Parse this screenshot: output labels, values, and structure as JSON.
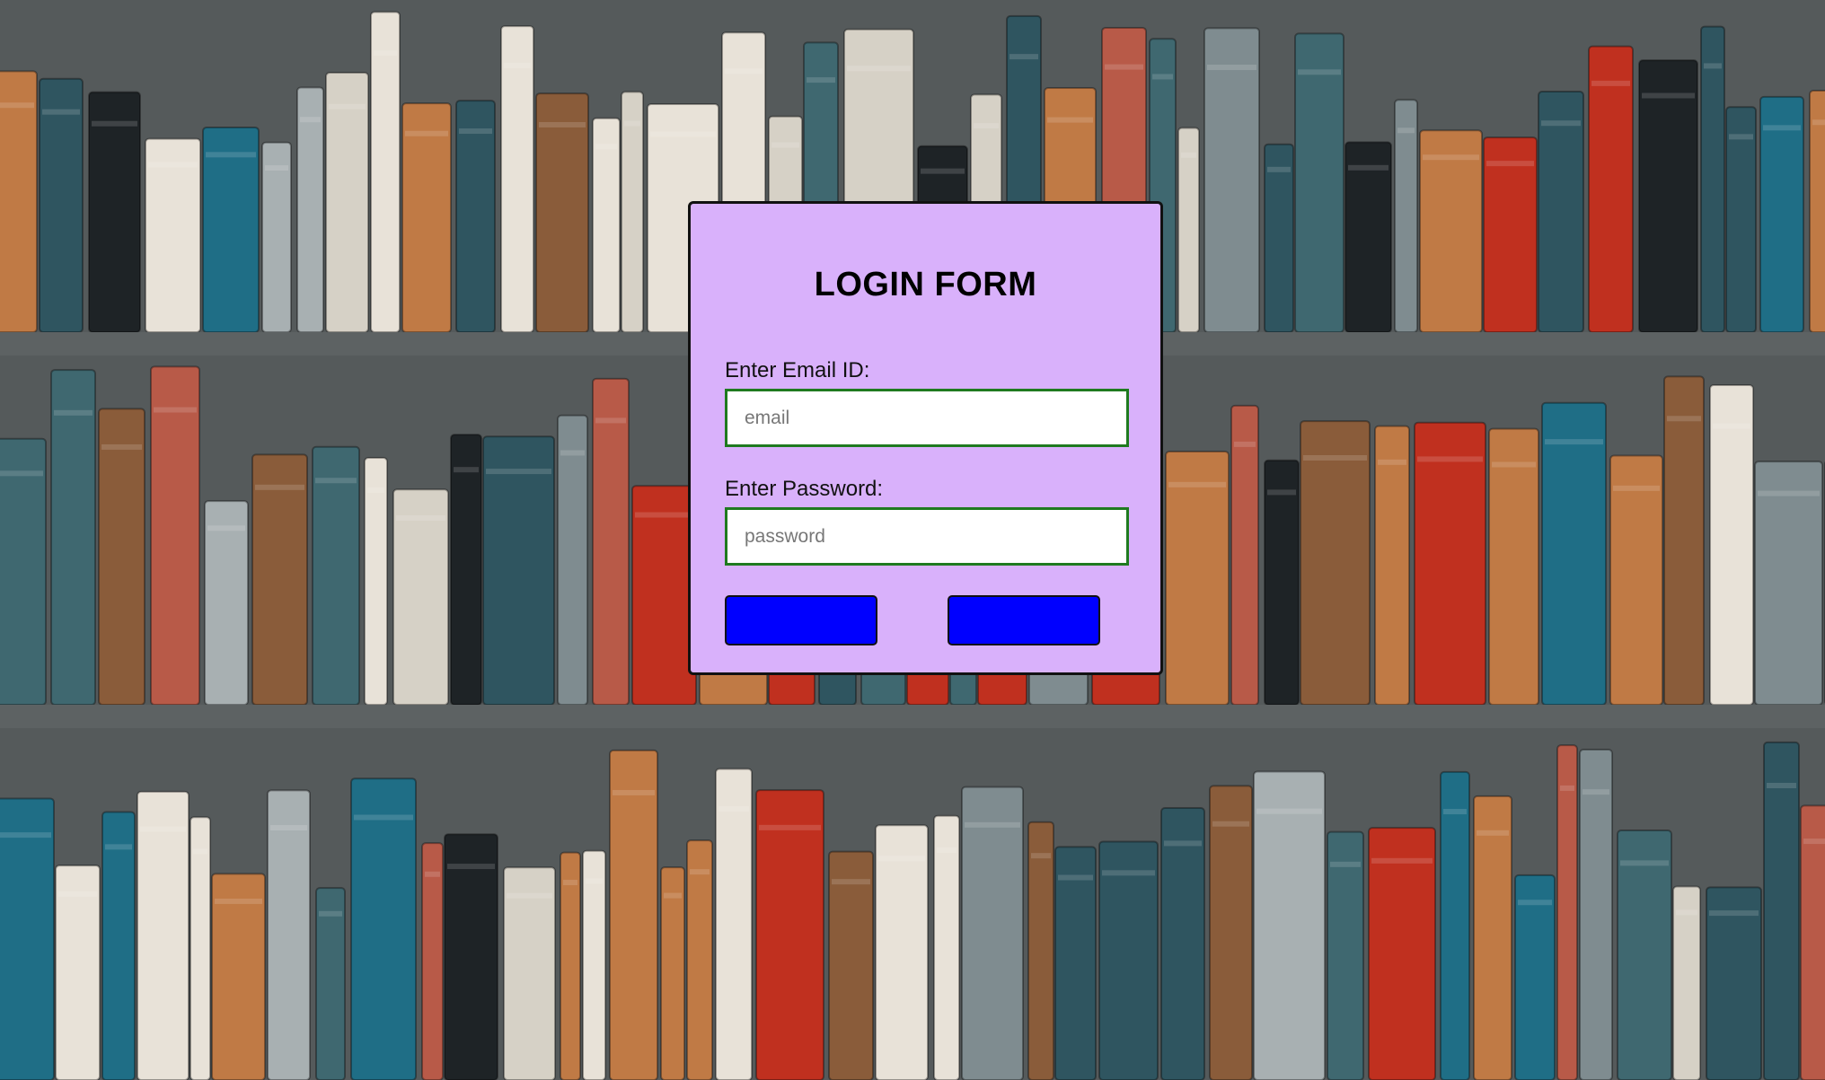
{
  "form": {
    "title": "LOGIN FORM",
    "email": {
      "label": "Enter Email ID:",
      "placeholder": "email",
      "value": ""
    },
    "password": {
      "label": "Enter Password:",
      "placeholder": "password",
      "value": ""
    },
    "buttons": {
      "primary_label": "",
      "secondary_label": ""
    }
  },
  "colors": {
    "card_background": "#d9b1fb",
    "input_border": "#1f7a1f",
    "button_background": "#0000ff"
  },
  "background": {
    "image": "bookshelf-photo"
  }
}
